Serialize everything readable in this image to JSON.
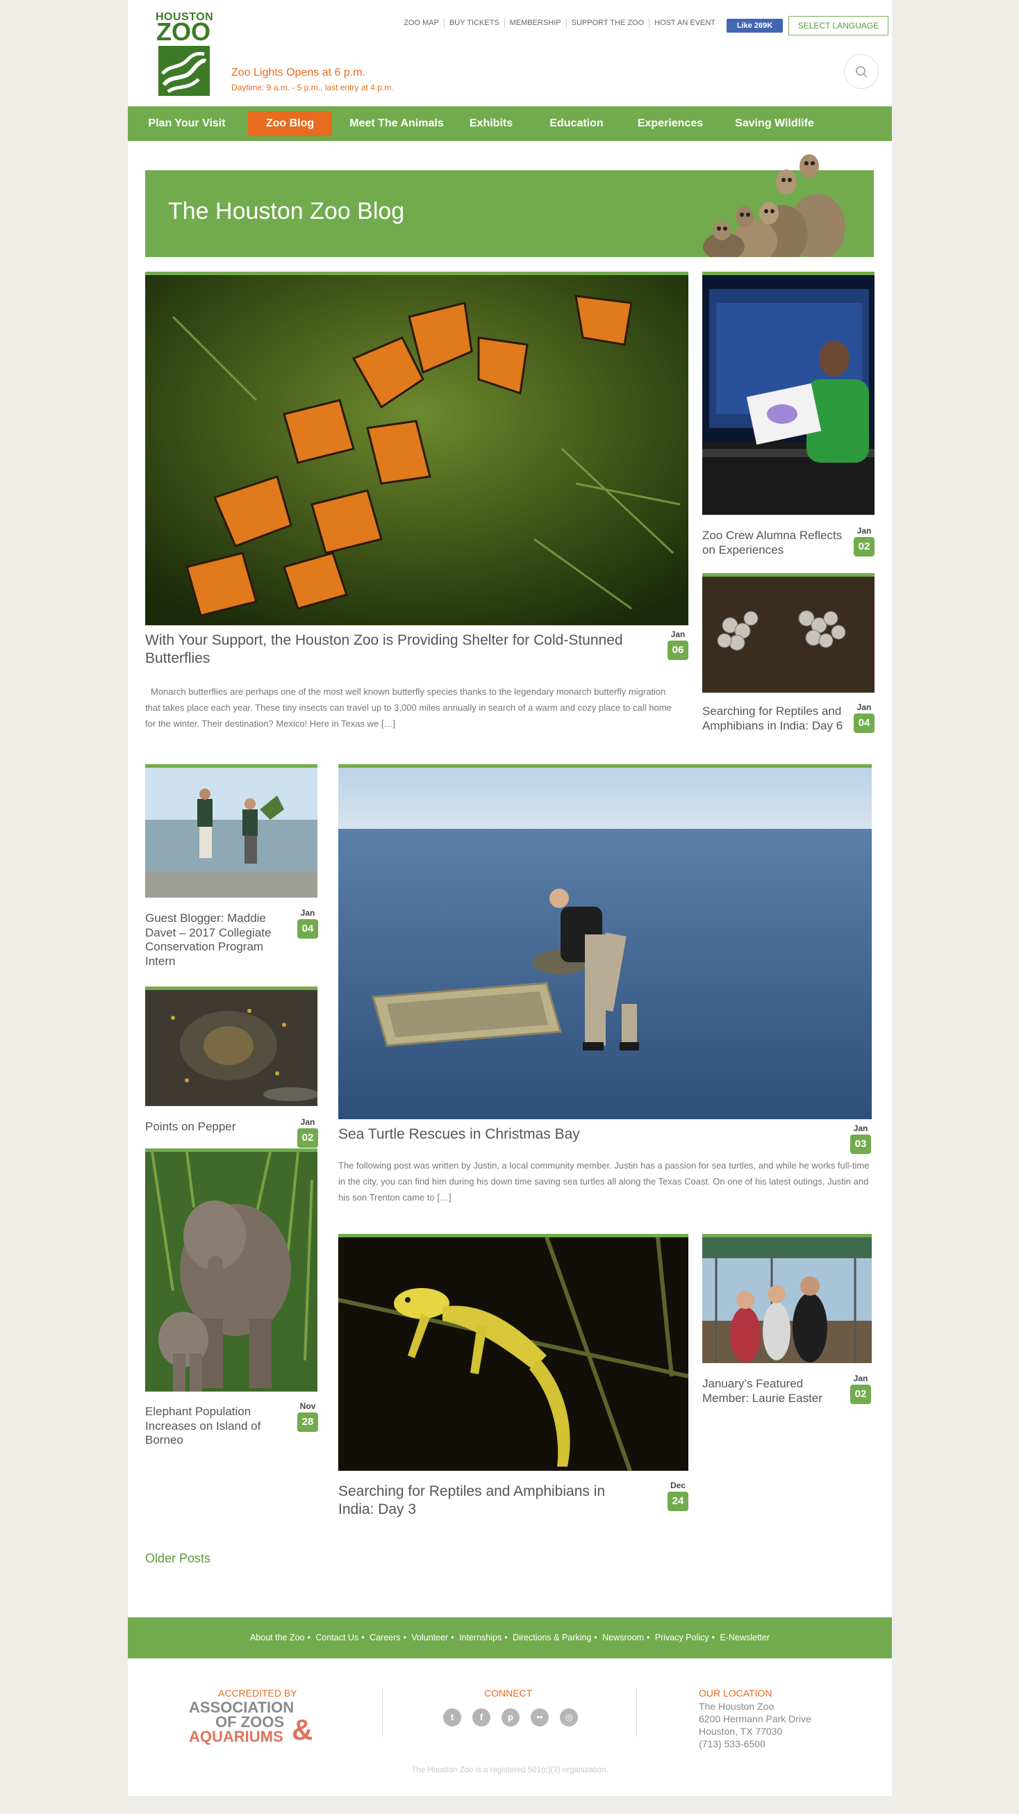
{
  "header": {
    "logo_line1": "HOUSTON",
    "logo_line2": "ZOO",
    "notice": "Zoo Lights Opens at 6 p.m.",
    "hours": "Daytime: 9 a.m. - 5 p.m., last entry at 4 p.m.",
    "top_links": [
      "ZOO MAP",
      "BUY TICKETS",
      "MEMBERSHIP",
      "SUPPORT THE ZOO",
      "HOST AN EVENT"
    ],
    "fb_like": "Like 269K",
    "language_button": "SELECT LANGUAGE"
  },
  "nav": {
    "items": [
      "Plan Your Visit",
      "Zoo Blog",
      "Meet The Animals",
      "Exhibits",
      "Education",
      "Experiences",
      "Saving Wildlife"
    ],
    "active": "Zoo Blog"
  },
  "banner": {
    "title": "The Houston Zoo Blog"
  },
  "posts": [
    {
      "title": "With Your Support, the Houston Zoo is Providing Shelter for Cold-Stunned Butterflies",
      "month": "Jan",
      "day": "06",
      "excerpt": "Monarch butterflies are perhaps one of the most well known butterfly species thanks to the legendary monarch butterfly migration that takes place each year. These tiny insects can travel up to 3,000 miles annually in search of a warm and cozy place to call home for the winter. Their destination? Mexico! Here in Texas we […]"
    },
    {
      "title": "Zoo Crew Alumna Reflects on Experiences",
      "month": "Jan",
      "day": "02"
    },
    {
      "title": "Searching for Reptiles and Amphibians in India: Day 6",
      "month": "Jan",
      "day": "04"
    },
    {
      "title": "Guest Blogger: Maddie Davet – 2017 Collegiate Conservation Program Intern",
      "month": "Jan",
      "day": "04"
    },
    {
      "title": "Sea Turtle Rescues in Christmas Bay",
      "month": "Jan",
      "day": "03",
      "excerpt": "The following post was written by Justin, a local community member. Justin has a passion for sea turtles, and while he works full-time in the city, you can find him during his down time saving sea turtles all along the Texas Coast. On one of  his latest outings, Justin and his son Trenton came to […]"
    },
    {
      "title": "Points on Pepper",
      "month": "Jan",
      "day": "02"
    },
    {
      "title": "Elephant Population Increases on Island of Borneo",
      "month": "Nov",
      "day": "28"
    },
    {
      "title": "Searching for Reptiles and Amphibians in India: Day 3",
      "month": "Dec",
      "day": "24"
    },
    {
      "title": "January’s Featured Member: Laurie Easter",
      "month": "Jan",
      "day": "02"
    }
  ],
  "older_posts": "Older Posts",
  "footer": {
    "links": [
      "About the Zoo",
      "Contact Us",
      "Careers",
      "Volunteer",
      "Internships",
      "Directions & Parking",
      "Newsroom",
      "Privacy Policy",
      "E-Newsletter"
    ],
    "accredited_title": "ACCREDITED BY",
    "aza_lines": [
      "ASSOCIATION",
      "OF ZOOS",
      "AQUARIUMS"
    ],
    "connect_title": "CONNECT",
    "social_icons": [
      "twitter-icon",
      "facebook-icon",
      "pinterest-icon",
      "flickr-icon",
      "instagram-icon"
    ],
    "location_title": "OUR LOCATION",
    "location_lines": [
      "The Houston Zoo",
      "6200 Hermann Park Drive",
      "Houston, TX 77030",
      "(713) 533-6500"
    ],
    "legal": "The Houston Zoo is a registered 501(c)(3) organization."
  },
  "colors": {
    "green": "#72ab4d",
    "orange": "#e96b1f",
    "dark_green": "#3d7a26"
  }
}
